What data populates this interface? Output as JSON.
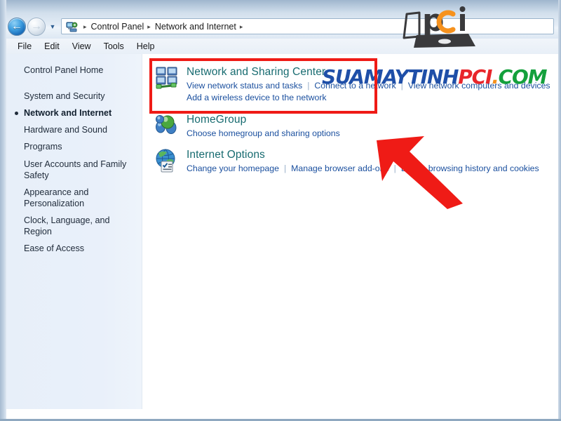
{
  "window": {
    "nav": {
      "back_label": "←",
      "back_name": "back-arrow-icon",
      "forward_label": "→",
      "dropdown_label": "▼"
    },
    "breadcrumb": {
      "icon_name": "control-panel-icon",
      "separator": "▸",
      "crumbs": [
        "Control Panel",
        "Network and Internet"
      ],
      "trailing_separator": "▸"
    },
    "menubar": {
      "items": [
        "File",
        "Edit",
        "View",
        "Tools",
        "Help"
      ]
    }
  },
  "sidebar": {
    "home_label": "Control Panel Home",
    "items": [
      {
        "label": "System and Security",
        "selected": false
      },
      {
        "label": "Network and Internet",
        "selected": true
      },
      {
        "label": "Hardware and Sound",
        "selected": false
      },
      {
        "label": "Programs",
        "selected": false
      },
      {
        "label": "User Accounts and Family Safety",
        "selected": false
      },
      {
        "label": "Appearance and Personalization",
        "selected": false
      },
      {
        "label": "Clock, Language, and Region",
        "selected": false
      },
      {
        "label": "Ease of Access",
        "selected": false
      }
    ]
  },
  "main": {
    "categories": [
      {
        "icon": "network-sharing-center-icon",
        "title": "Network and Sharing Center",
        "links_row1": [
          "View network status and tasks",
          "Connect to a network",
          "View network computers and devices"
        ],
        "links_row2": [
          "Add a wireless device to the network"
        ]
      },
      {
        "icon": "homegroup-icon",
        "title": "HomeGroup",
        "links_row1": [
          "Choose homegroup and sharing options"
        ],
        "links_row2": []
      },
      {
        "icon": "internet-options-icon",
        "title": "Internet Options",
        "links_row1": [
          "Change your homepage",
          "Manage browser add-ons",
          "Delete browsing history and cookies"
        ],
        "links_row2": []
      }
    ]
  },
  "annotations": {
    "highlight_box_color": "#ef1b16",
    "arrow_color": "#ef1b16",
    "highlight_target": "Network and Sharing Center",
    "arrow_target": "Network and Sharing Center"
  },
  "watermark": {
    "logo_text": "pci",
    "site_parts": [
      {
        "text": "SUAMAYTINH",
        "color": "#1f4fa8"
      },
      {
        "text": "PCI",
        "color": "#e8252a"
      },
      {
        "text": ".",
        "color": "#f6921e"
      },
      {
        "text": "COM",
        "color": "#14a03c"
      }
    ]
  }
}
